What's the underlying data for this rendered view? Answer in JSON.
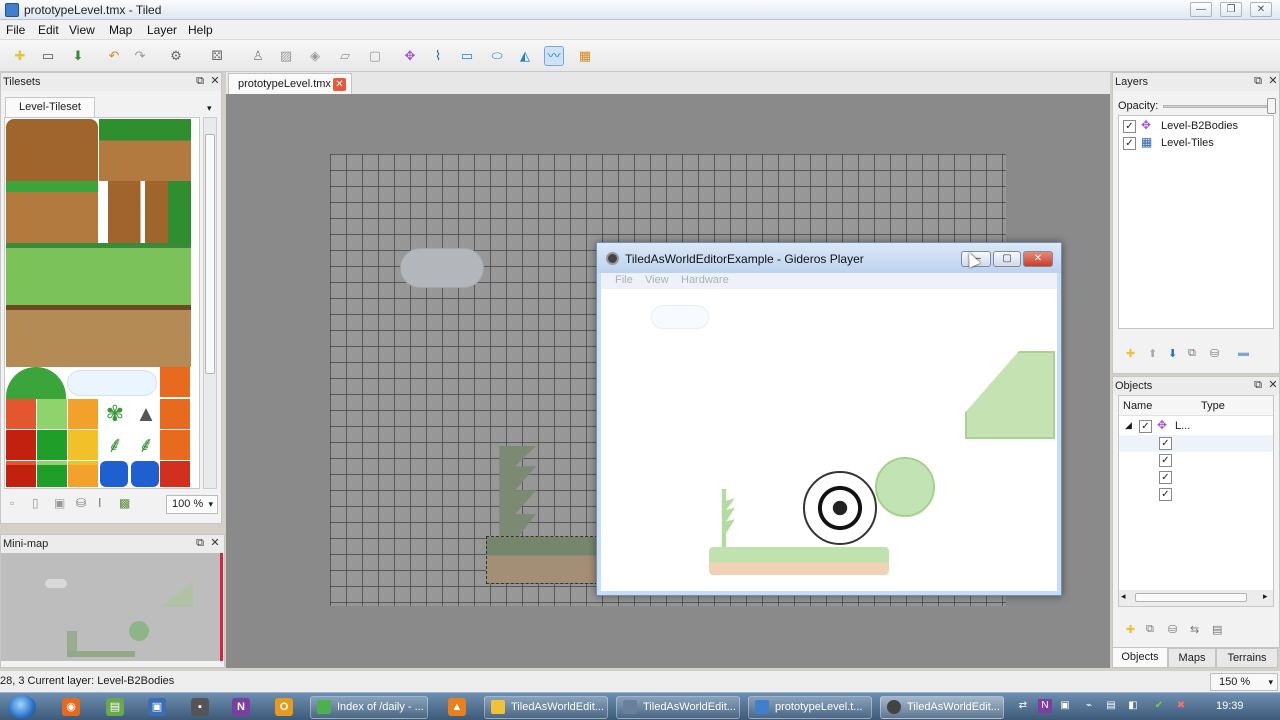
{
  "window": {
    "title": "prototypeLevel.tmx - Tiled"
  },
  "menu": [
    "File",
    "Edit",
    "View",
    "Map",
    "Layer",
    "Help"
  ],
  "toolbar": {
    "icons": [
      "new-file-icon",
      "open-file-icon",
      "save-icon",
      "undo-icon",
      "redo-icon",
      "commands-icon",
      "random-mode-icon",
      "stamp-brush-icon",
      "terrain-brush-icon",
      "bucket-fill-icon",
      "eraser-icon",
      "rectangle-select-icon",
      "select-objects-icon",
      "edit-polygons-icon",
      "insert-rectangle-icon",
      "insert-ellipse-icon",
      "insert-polygon-icon",
      "insert-polyline-icon",
      "insert-tile-icon"
    ],
    "active_tool": "insert-polyline-icon"
  },
  "tilesets": {
    "title": "Tilesets",
    "tab": "Level-Tileset",
    "zoom": "100 %"
  },
  "minimap": {
    "title": "Mini-map"
  },
  "document": {
    "tab_label": "prototypeLevel.tmx"
  },
  "player": {
    "title": "TiledAsWorldEditorExample - Gideros Player",
    "menu": [
      "File",
      "View",
      "Hardware"
    ]
  },
  "layers": {
    "title": "Layers",
    "opacity_label": "Opacity:",
    "items": [
      {
        "name": "Level-B2Bodies",
        "visible": true,
        "icon": "object-layer-icon"
      },
      {
        "name": "Level-Tiles",
        "visible": true,
        "icon": "tile-layer-icon"
      }
    ]
  },
  "objects": {
    "title": "Objects",
    "columns": [
      "Name",
      "Type"
    ],
    "group_label": "L...",
    "child_rows": 4
  },
  "right_tabs": [
    "Objects",
    "Maps",
    "Terrains"
  ],
  "status": {
    "text": "28, 3  Current layer: Level-B2Bodies",
    "zoom": "150 %"
  },
  "taskbar": {
    "tasks": [
      {
        "label": "Index of /daily - ...",
        "color": "#4caf50"
      },
      {
        "label": "TiledAsWorldEdit...",
        "color": "#f0c23a"
      },
      {
        "label": "TiledAsWorldEdit...",
        "color": "#6a7f99"
      },
      {
        "label": "prototypeLevel.t...",
        "color": "#3f7fce"
      },
      {
        "label": "TiledAsWorldEdit...",
        "color": "#444444"
      }
    ],
    "clock": "19:39"
  }
}
